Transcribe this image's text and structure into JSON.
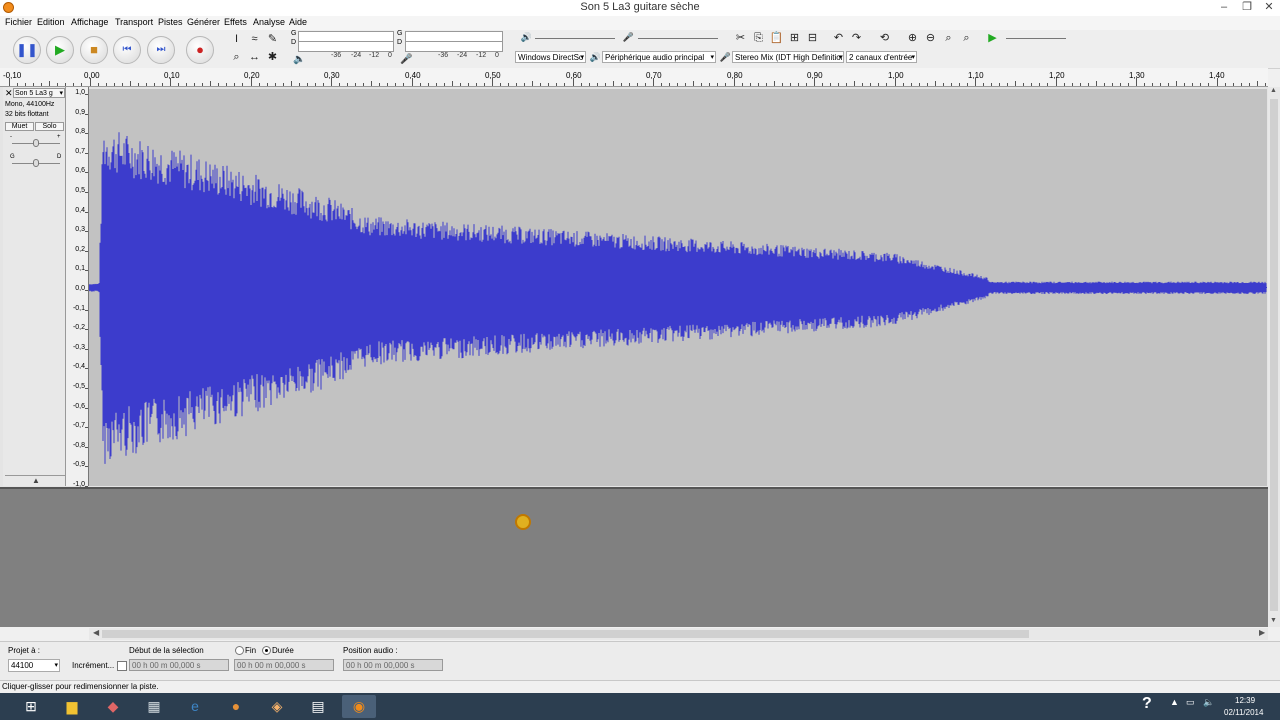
{
  "window": {
    "title": "Son 5 La3 guitare sèche",
    "min": "–",
    "max": "❐",
    "close": "✕"
  },
  "menu": [
    "Fichier",
    "Edition",
    "Affichage",
    "Transport",
    "Pistes",
    "Générer",
    "Effets",
    "Analyse",
    "Aide"
  ],
  "meters": {
    "g": "G",
    "d": "D",
    "play_scale": [
      "-36",
      "-24",
      "-12",
      "0"
    ],
    "rec_scale": [
      "-36",
      "-24",
      "-12",
      "0"
    ]
  },
  "devices": {
    "host": "Windows DirectSo",
    "output": "Périphérique audio principal",
    "input": "Stereo Mix (IDT High Definition",
    "channels": "2 canaux d'entrée"
  },
  "ruler": [
    "-0,10",
    "0,00",
    "0,10",
    "0,20",
    "0,30",
    "0,40",
    "0,50",
    "0,60",
    "0,70",
    "0,80",
    "0,90",
    "1,00",
    "1,10",
    "1,20",
    "1,30",
    "1,40"
  ],
  "track": {
    "name": "Son 5 La3 g",
    "format": "Mono, 44100Hz",
    "bits": "32 bits flottant",
    "mute": "Muet",
    "solo": "Solo",
    "gain_minus": "-",
    "gain_plus": "+",
    "pan_left": "G",
    "pan_right": "D"
  },
  "vscale": [
    "1,0",
    "0,9",
    "0,8",
    "0,7",
    "0,6",
    "0,5",
    "0,4",
    "0,3",
    "0,2",
    "0,1",
    "0,0",
    "-0,1",
    "-0,2",
    "-0,3",
    "-0,4",
    "-0,5",
    "-0,6",
    "-0,7",
    "-0,8",
    "-0,9",
    "-1,0"
  ],
  "selection": {
    "project_rate_label": "Projet à :",
    "project_rate": "44100",
    "snap_label": "Incrément...",
    "start_label": "Début de la sélection",
    "end_label": "Fin",
    "length_label": "Durée",
    "audio_pos_label": "Position audio :",
    "start_value": "00 h 00 m 00,000 s",
    "end_value": "00 h 00 m 00,000 s",
    "audio_pos_value": "00 h 00 m 00,000 s"
  },
  "status": "Cliquer-glisser pour redimensionner la piste.",
  "taskbar": {
    "time": "12:39",
    "date": "02/11/2014"
  },
  "colors": {
    "waveform": "#3333cc",
    "wave_bg": "#c2c2c2",
    "empty_bg": "#808080"
  }
}
